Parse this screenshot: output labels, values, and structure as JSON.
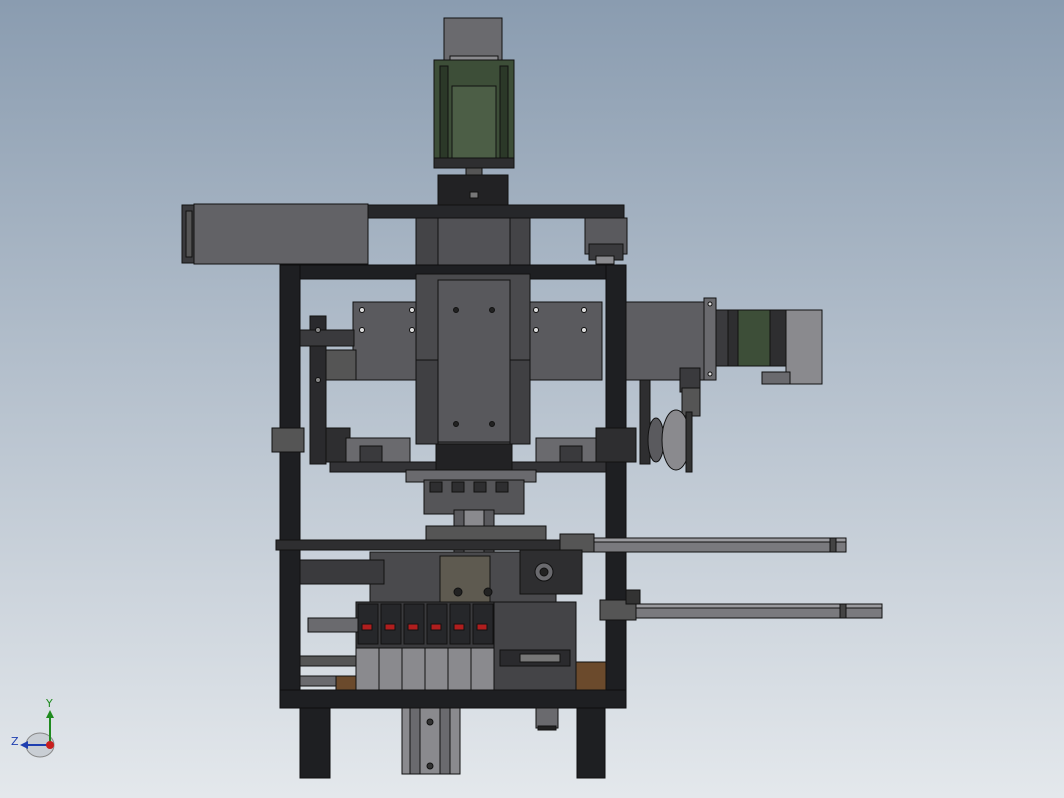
{
  "viewport": {
    "background_top": "#8a9cb0",
    "background_bottom": "#e4e8ec",
    "colors": {
      "frame": "#1e1f22",
      "body_dark": "#444447",
      "body_mid": "#616165",
      "body_light": "#8a8a8e",
      "motor_green": "#3d4e38",
      "valve_red": "#b01e1e",
      "brass": "#6b4a2c",
      "rod": "#7a7a7e"
    }
  },
  "triad": {
    "y_label": "Y",
    "z_label": "Z",
    "y_color": "#1f8a1f",
    "z_color": "#1f3fb0",
    "origin_color": "#c81e1e"
  }
}
